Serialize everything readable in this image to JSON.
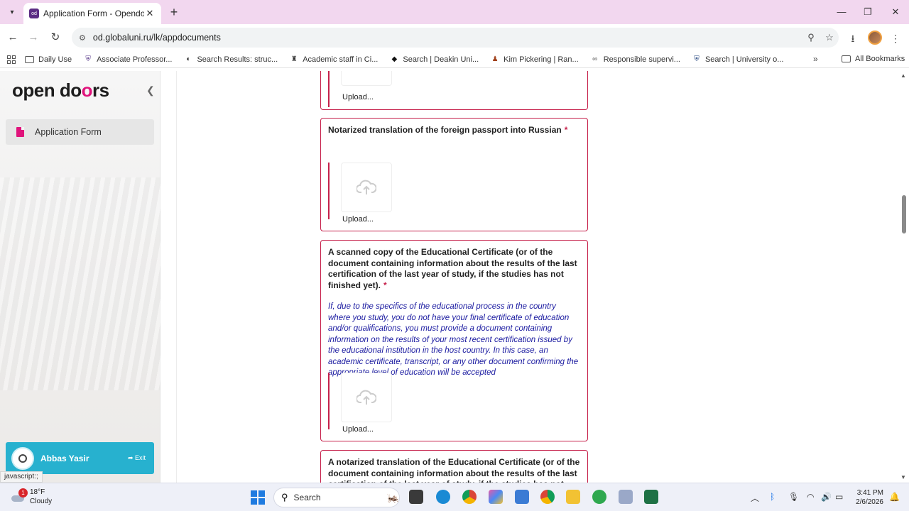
{
  "browser": {
    "tab_title": "Application Form - Opendoors",
    "url": "od.globaluni.ru/lk/appdocuments",
    "bookmarks": [
      {
        "label": "Daily Use",
        "icon": "folder-icon"
      },
      {
        "label": "Associate Professor...",
        "icon": "university-shield-icon"
      },
      {
        "label": "Search Results: struc...",
        "icon": "search-results-icon"
      },
      {
        "label": "Academic staff in Ci...",
        "icon": "crest-icon"
      },
      {
        "label": "Search | Deakin Uni...",
        "icon": "deakin-icon"
      },
      {
        "label": "Kim Pickering | Ran...",
        "icon": "person-icon"
      },
      {
        "label": "Responsible supervi...",
        "icon": "link-icon"
      },
      {
        "label": "Search | University o...",
        "icon": "shield-icon"
      }
    ],
    "all_bookmarks": "All Bookmarks"
  },
  "sidebar": {
    "logo_pre": "open do",
    "logo_o": "o",
    "logo_post": "rs",
    "nav_item": "Application Form",
    "user_name": "Abbas Yasir",
    "exit_label": "Exit"
  },
  "documents": [
    {
      "title": "",
      "upload_label": "Upload..."
    },
    {
      "title": "Notarized translation of the foreign passport into Russian",
      "required_mark": "*",
      "upload_label": "Upload..."
    },
    {
      "title": "A scanned copy of the Educational Certificate (or of the document containing information about the results of the last certification of the last year of study, if the studies has not finished yet).",
      "required_mark": "*",
      "note": "If, due to the specifics of the educational process in the country where you study, you do not have your final certificate of education and/or qualifications, you must provide a document containing information on the results of your most recent certification issued by the educational institution in the host country. In this case, an academic certificate, transcript, or any other document confirming the appropriate level of education will be accepted",
      "upload_label": "Upload..."
    },
    {
      "title": "A notarized translation of the Educational Certificate (or of the document containing information about the results of the last certification of the last year of study, if the studies has not"
    }
  ],
  "status_bar_link": "javascript:;",
  "taskbar": {
    "temperature": "18°F",
    "condition": "Cloudy",
    "weather_badge": "1",
    "search_placeholder": "Search",
    "time": "3:41 PM",
    "date": "2/6/2026"
  },
  "colors": {
    "accent_pink": "#e0147c",
    "card_border": "#c6214b",
    "note_blue": "#1a1aa0",
    "user_card": "#27b1cf",
    "tabbar": "#f2d7ef"
  }
}
